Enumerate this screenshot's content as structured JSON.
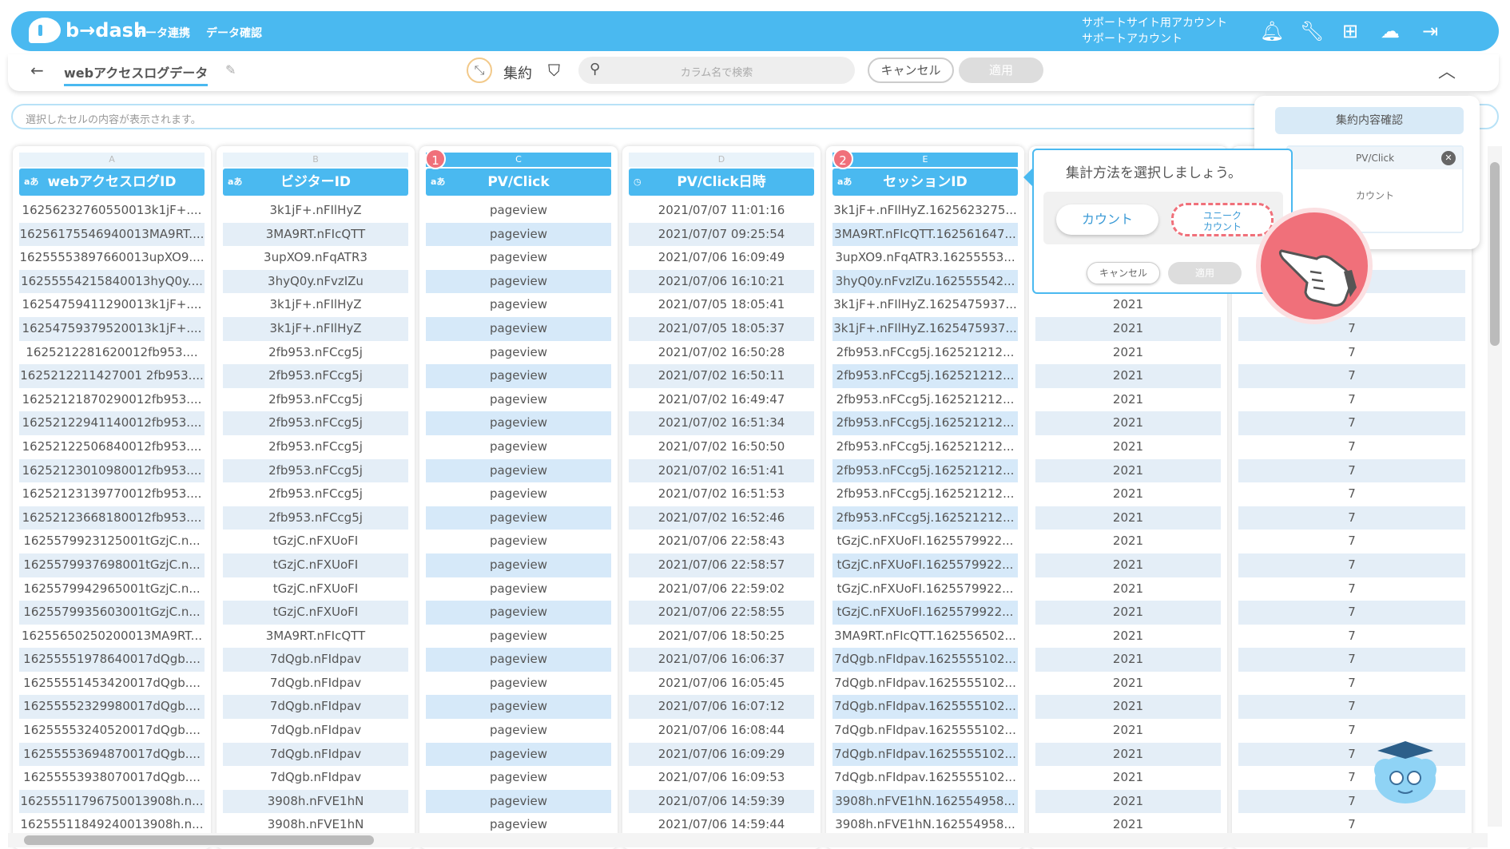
{
  "brand": {
    "logo_text": "b→dash"
  },
  "nav": {
    "data_link": "データ連携",
    "data_check": "データ確認"
  },
  "account": {
    "line1": "サポートサイト用アカウント",
    "line2": "サポートアカウント"
  },
  "toolbar": {
    "table_name": "webアクセスログデータ",
    "aggregate_label": "集約",
    "search_placeholder": "カラム名で検索",
    "cancel_label": "キャンセル",
    "apply_label": "適用"
  },
  "cell_bar": {
    "placeholder": "選択したセルの内容が表示されます。"
  },
  "badges": [
    "1",
    "2"
  ],
  "columns": [
    {
      "letter": "A",
      "type": "aあ",
      "name": "webアクセスログID",
      "rows": [
        "16256232760550013k1jF+....",
        "16256175546940013MA9RT....",
        "16255553897660013upXO9....",
        "16255554215840013hyQ0y....",
        "16254759411290013k1jF+....",
        "16254759379520013k1jF+....",
        "1625212281620012fb953....",
        "1625212211427001 2fb953....",
        "16252121870290012fb953....",
        "16252122941140012fb953....",
        "16252122506840012fb953....",
        "16252123010980012fb953....",
        "16252123139770012fb953....",
        "16252123668180012fb953....",
        "1625579923125001tGzjC.n...",
        "1625579937698001tGzjC.n...",
        "1625579942965001tGzjC.n...",
        "1625579935603001tGzjC.n...",
        "16255650250200013MA9RT...",
        "16255551978640017dQgb....",
        "16255551453420017dQgb....",
        "16255552329980017dQgb....",
        "16255553240520017dQgb....",
        "16255553694870017dQgb....",
        "16255553938070017dQgb....",
        "16255511796750013908h.n...",
        "16255511849240013908h.n..."
      ]
    },
    {
      "letter": "B",
      "type": "aあ",
      "name": "ビジターID",
      "rows": [
        "3k1jF+.nFIlHyZ",
        "3MA9RT.nFIcQTT",
        "3upXO9.nFqATR3",
        "3hyQ0y.nFvzIZu",
        "3k1jF+.nFIlHyZ",
        "3k1jF+.nFIlHyZ",
        "2fb953.nFCcg5j",
        "2fb953.nFCcg5j",
        "2fb953.nFCcg5j",
        "2fb953.nFCcg5j",
        "2fb953.nFCcg5j",
        "2fb953.nFCcg5j",
        "2fb953.nFCcg5j",
        "2fb953.nFCcg5j",
        "tGzjC.nFXUoFI",
        "tGzjC.nFXUoFI",
        "tGzjC.nFXUoFI",
        "tGzjC.nFXUoFI",
        "3MA9RT.nFIcQTT",
        "7dQgb.nFIdpav",
        "7dQgb.nFIdpav",
        "7dQgb.nFIdpav",
        "7dQgb.nFIdpav",
        "7dQgb.nFIdpav",
        "7dQgb.nFIdpav",
        "3908h.nFVE1hN",
        "3908h.nFVE1hN"
      ]
    },
    {
      "letter": "C",
      "type": "aあ",
      "name": "PV/Click",
      "rows": [
        "pageview",
        "pageview",
        "pageview",
        "pageview",
        "pageview",
        "pageview",
        "pageview",
        "pageview",
        "pageview",
        "pageview",
        "pageview",
        "pageview",
        "pageview",
        "pageview",
        "pageview",
        "pageview",
        "pageview",
        "pageview",
        "pageview",
        "pageview",
        "pageview",
        "pageview",
        "pageview",
        "pageview",
        "pageview",
        "pageview",
        "pageview"
      ]
    },
    {
      "letter": "D",
      "type": "◷",
      "name": "PV/Click日時",
      "rows": [
        "2021/07/07 11:01:16",
        "2021/07/07 09:25:54",
        "2021/07/06 16:09:49",
        "2021/07/06 16:10:21",
        "2021/07/05 18:05:41",
        "2021/07/05 18:05:37",
        "2021/07/02 16:50:28",
        "2021/07/02 16:50:11",
        "2021/07/02 16:49:47",
        "2021/07/02 16:51:34",
        "2021/07/02 16:50:50",
        "2021/07/02 16:51:41",
        "2021/07/02 16:51:53",
        "2021/07/02 16:52:46",
        "2021/07/06 22:58:43",
        "2021/07/06 22:58:57",
        "2021/07/06 22:59:02",
        "2021/07/06 22:58:55",
        "2021/07/06 18:50:25",
        "2021/07/06 16:06:37",
        "2021/07/06 16:05:45",
        "2021/07/06 16:07:12",
        "2021/07/06 16:08:44",
        "2021/07/06 16:09:29",
        "2021/07/06 16:09:53",
        "2021/07/06 14:59:39",
        "2021/07/06 14:59:44"
      ]
    },
    {
      "letter": "E",
      "type": "aあ",
      "name": "セッションID",
      "rows": [
        "3k1jF+.nFIlHyZ.1625623275...",
        "3MA9RT.nFIcQTT.162561647...",
        "3upXO9.nFqATR3.16255553...",
        "3hyQ0y.nFvzIZu.162555542...",
        "3k1jF+.nFIlHyZ.1625475937...",
        "3k1jF+.nFIlHyZ.1625475937...",
        "2fb953.nFCcg5j.162521212...",
        "2fb953.nFCcg5j.162521212...",
        "2fb953.nFCcg5j.162521212...",
        "2fb953.nFCcg5j.162521212...",
        "2fb953.nFCcg5j.162521212...",
        "2fb953.nFCcg5j.162521212...",
        "2fb953.nFCcg5j.162521212...",
        "2fb953.nFCcg5j.162521212...",
        "tGzjC.nFXUoFI.1625579922...",
        "tGzjC.nFXUoFI.1625579922...",
        "tGzjC.nFXUoFI.1625579922...",
        "tGzjC.nFXUoFI.1625579922...",
        "3MA9RT.nFIcQTT.162556502...",
        "7dQgb.nFIdpav.1625555102...",
        "7dQgb.nFIdpav.1625555102...",
        "7dQgb.nFIdpav.1625555102...",
        "7dQgb.nFIdpav.1625555102...",
        "7dQgb.nFIdpav.1625555102...",
        "7dQgb.nFIdpav.1625555102...",
        "3908h.nFVE1hN.162554958...",
        "3908h.nFVE1hN.162554958..."
      ]
    },
    {
      "letter": "",
      "type": "",
      "name": "",
      "rows": [
        "",
        "",
        "",
        "",
        "2021",
        "2021",
        "2021",
        "2021",
        "2021",
        "2021",
        "2021",
        "2021",
        "2021",
        "2021",
        "2021",
        "2021",
        "2021",
        "2021",
        "2021",
        "2021",
        "2021",
        "2021",
        "2021",
        "2021",
        "2021",
        "2021",
        "2021"
      ]
    },
    {
      "letter": "",
      "type": "",
      "name": "",
      "rows": [
        "",
        "",
        "",
        "",
        "",
        "7",
        "7",
        "7",
        "7",
        "7",
        "7",
        "7",
        "7",
        "7",
        "7",
        "7",
        "7",
        "7",
        "7",
        "7",
        "7",
        "7",
        "7",
        "7",
        "7",
        "7",
        "7"
      ]
    }
  ],
  "agg_popup": {
    "title": "集計方法を選択しましょう。",
    "count": "カウント",
    "unique_line1": "ユニーク",
    "unique_line2": "カウント",
    "cancel": "キャンセル",
    "apply": "適用"
  },
  "confirm_panel": {
    "title": "集約内容確認",
    "column": "PV/Click",
    "method": "カウント"
  },
  "colors": {
    "accent": "#4ab9f0",
    "highlight": "#f0707a"
  }
}
